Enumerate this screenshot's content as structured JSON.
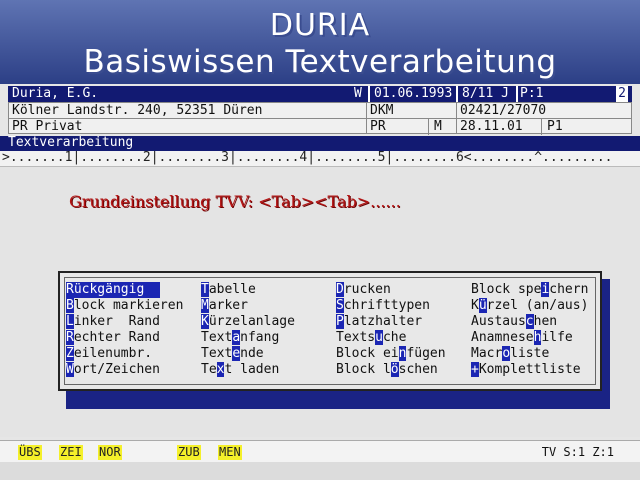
{
  "banner": {
    "line1": "DURIA",
    "line2": "Basiswissen Textverarbeitung"
  },
  "infobar": {
    "name": "Duria, E.G.",
    "flag": "W",
    "date": "01.06.1993",
    "age": "8/11 J",
    "page": "P:1",
    "number": "2"
  },
  "info2": {
    "address": "Kölner Landstr. 240, 52351 Düren",
    "insurer": "DKM",
    "phone": "02421/27070",
    "status": "PR Privat",
    "status_code": "PR",
    "sex": "M",
    "visit_date": "28.11.01",
    "visit_code": "P1"
  },
  "title": "Textverarbeitung",
  "ruler": ">.......1|........2|........3|........4|........5|........6<........^.........",
  "instruction": "Grundeinstellung TVV: <Tab><Tab>......",
  "menu": [
    [
      {
        "pre": "",
        "key": "",
        "post": "Rückgängig",
        "selected": true
      },
      {
        "pre": "",
        "key": "B",
        "post": "lock markieren"
      },
      {
        "pre": "",
        "key": "L",
        "post": "inker  Rand"
      },
      {
        "pre": "",
        "key": "R",
        "post": "echter Rand"
      },
      {
        "pre": "",
        "key": "Z",
        "post": "eilenumbr."
      },
      {
        "pre": "",
        "key": "W",
        "post": "ort/Zeichen"
      }
    ],
    [
      {
        "pre": "",
        "key": "T",
        "post": "abelle"
      },
      {
        "pre": "",
        "key": "M",
        "post": "arker"
      },
      {
        "pre": "",
        "key": "K",
        "post": "ürzelanlage"
      },
      {
        "pre": "Text",
        "key": "a",
        "post": "nfang"
      },
      {
        "pre": "Text",
        "key": "e",
        "post": "nde"
      },
      {
        "pre": "Te",
        "key": "x",
        "post": "t laden"
      }
    ],
    [
      {
        "pre": "",
        "key": "D",
        "post": "rucken"
      },
      {
        "pre": "",
        "key": "S",
        "post": "chrifttypen"
      },
      {
        "pre": "",
        "key": "P",
        "post": "latzhalter"
      },
      {
        "pre": "Texts",
        "key": "u",
        "post": "che"
      },
      {
        "pre": "Block ei",
        "key": "n",
        "post": "fügen"
      },
      {
        "pre": "Block l",
        "key": "ö",
        "post": "schen"
      }
    ],
    [
      {
        "pre": "Block spe",
        "key": "i",
        "post": "chern"
      },
      {
        "pre": "K",
        "key": "ü",
        "post": "rzel (an/aus)"
      },
      {
        "pre": "Austaus",
        "key": "c",
        "post": "hen"
      },
      {
        "pre": "Anamnese",
        "key": "h",
        "post": "ilfe"
      },
      {
        "pre": "Macr",
        "key": "o",
        "post": "liste"
      },
      {
        "pre": "",
        "key": "+",
        "post": "Komplettliste"
      }
    ]
  ],
  "fkeys": [
    "ÜBS",
    "ZEI",
    "NOR",
    "ZUB",
    "MEN"
  ],
  "status_right": "TV S:1 Z:1"
}
